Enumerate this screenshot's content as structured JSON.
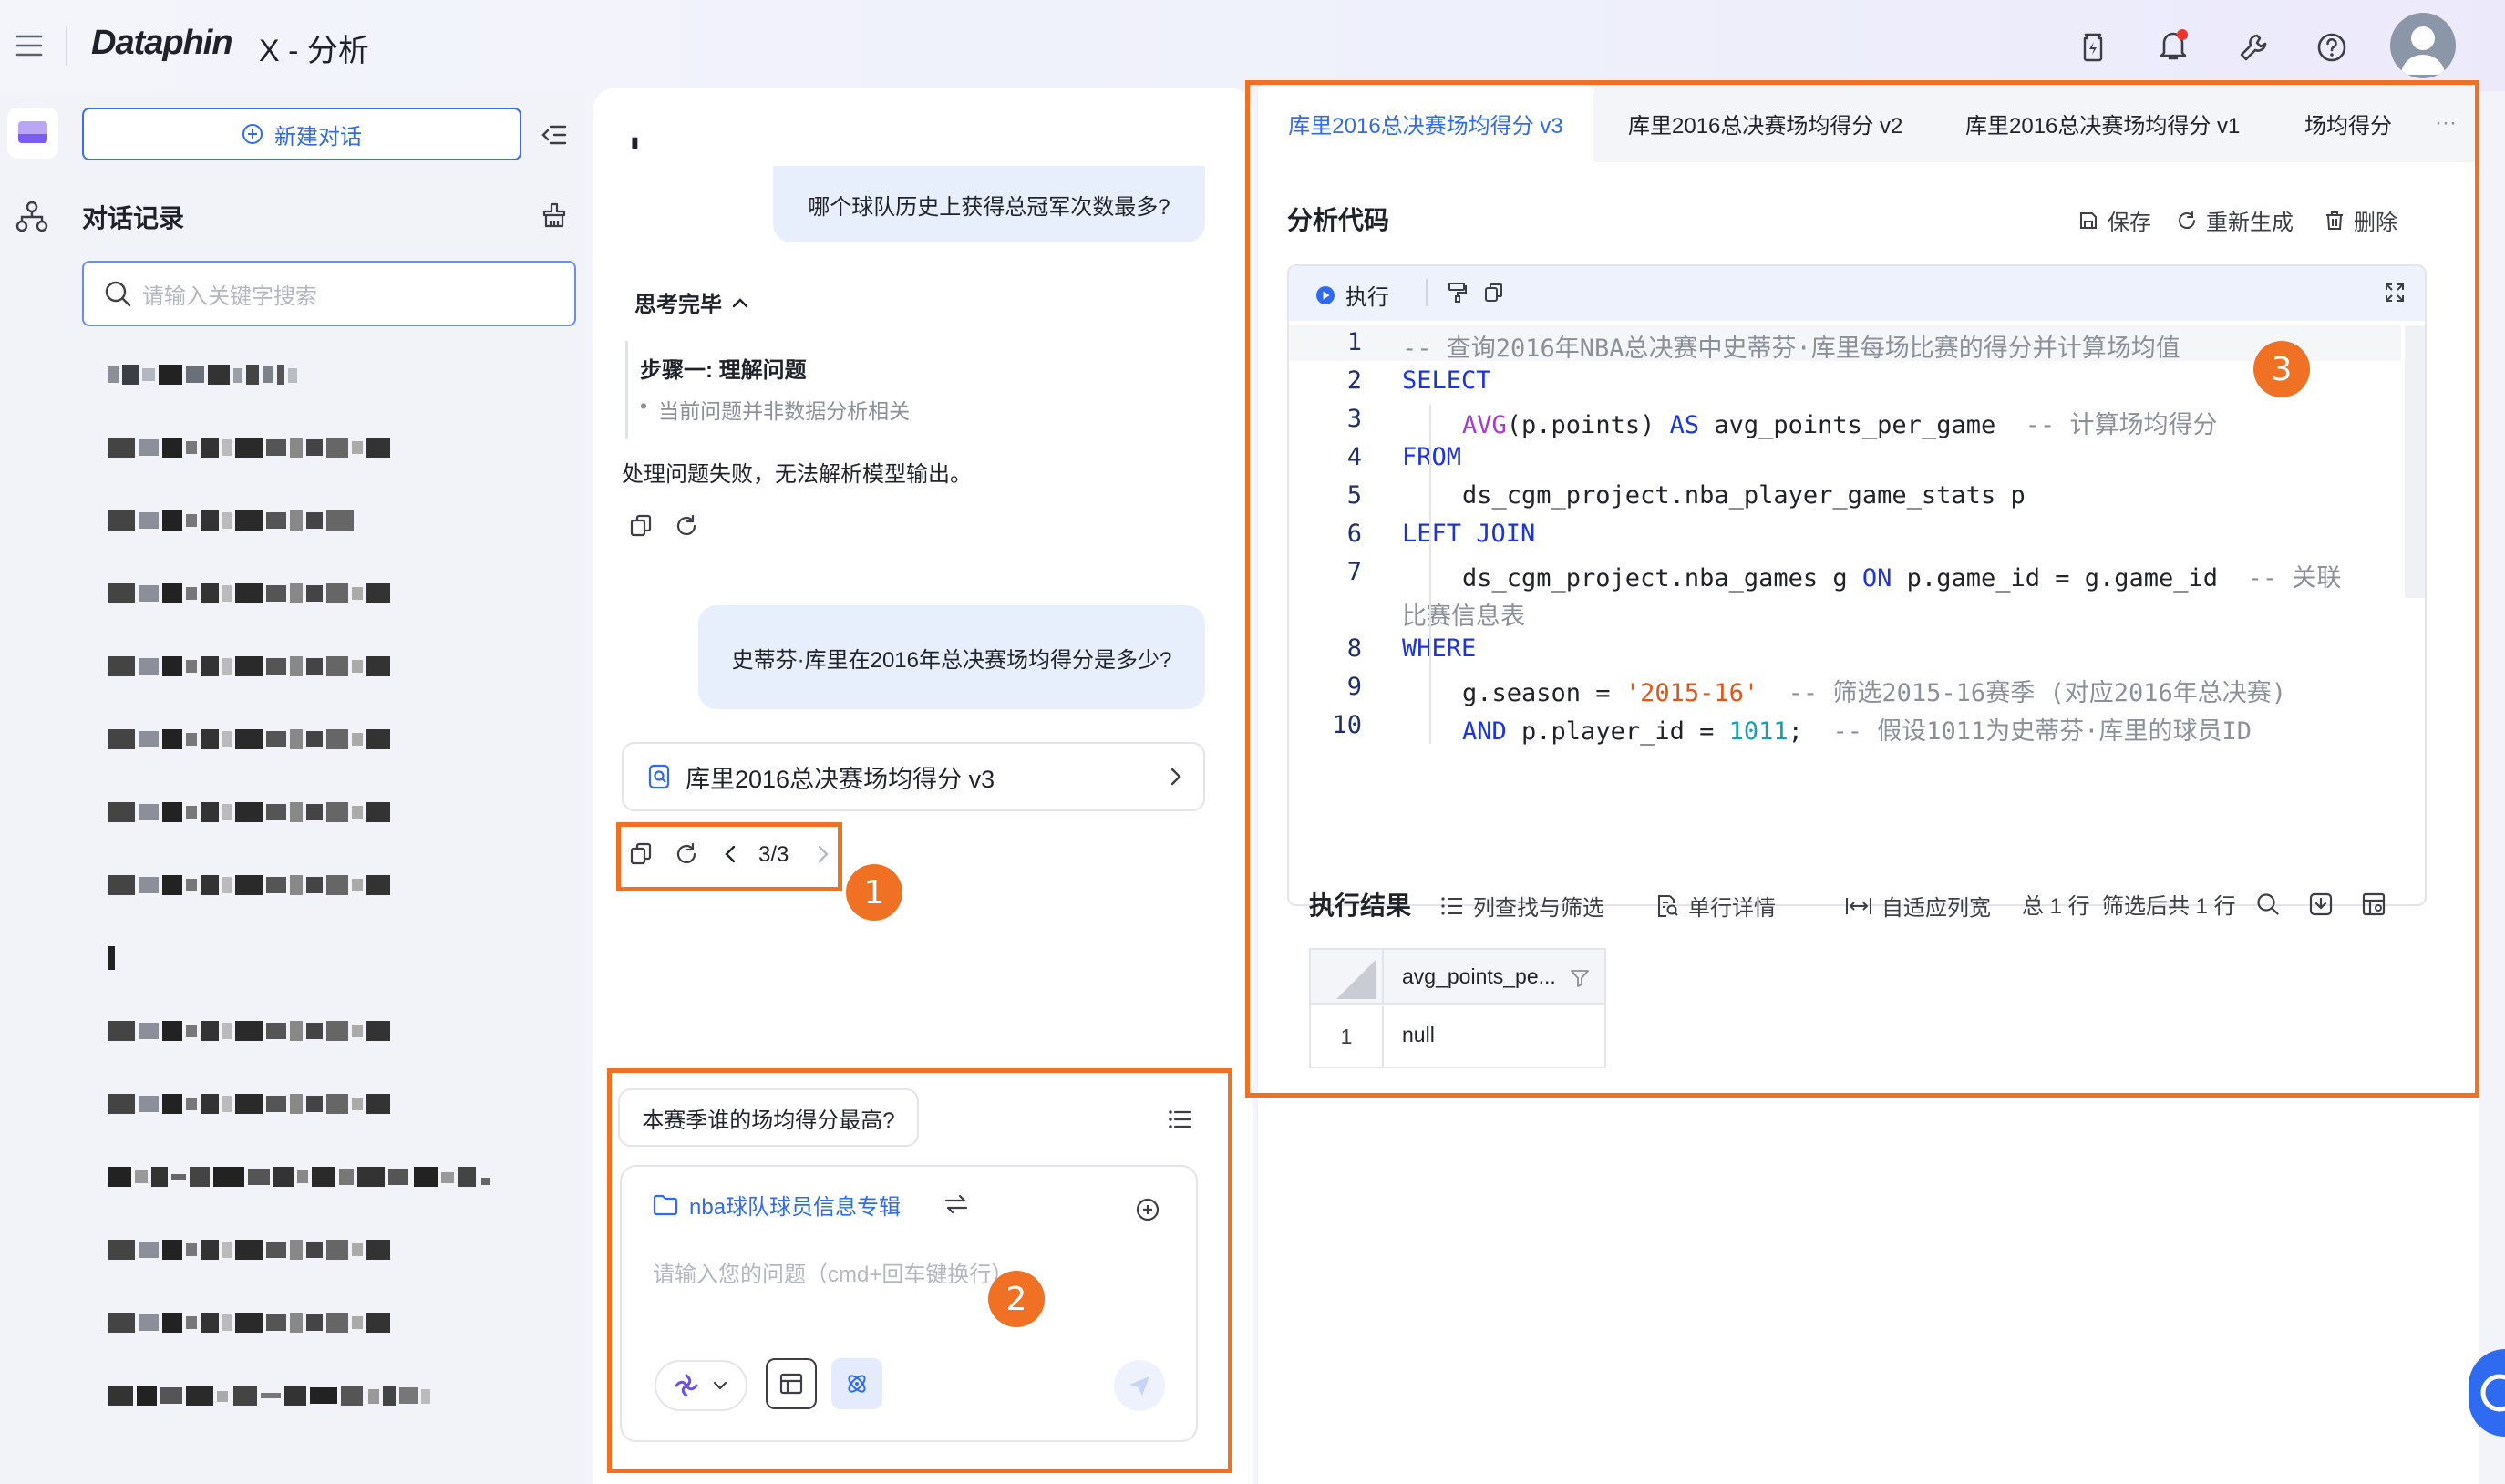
{
  "app": {
    "logo": "Dataphin",
    "title": "X - 分析"
  },
  "colors": {
    "accent": "#2f6bf1",
    "highlight": "#f07124",
    "bubble": "#e8effc"
  },
  "sidebar": {
    "new_chat": "新建对话",
    "history_title": "对话记录",
    "search_placeholder": "请输入关键字搜索"
  },
  "chat": {
    "cursor_mark": "▮",
    "q1": "哪个球队历史上获得总冠军次数最多?",
    "thinking_label": "思考完毕",
    "step_title": "步骤一: 理解问题",
    "step_detail": "当前问题并非数据分析相关",
    "error_text": "处理问题失败，无法解析模型输出。",
    "q2": "史蒂芬·库里在2016年总决赛场均得分是多少?",
    "result_card": "库里2016总决赛场均得分 v3",
    "pager": "3/3",
    "suggestion": "本赛季谁的场均得分最高?",
    "dataset": "nba球队球员信息专辑",
    "input_placeholder": "请输入您的问题（cmd+回车键换行）"
  },
  "badges": {
    "b1": "1",
    "b2": "2",
    "b3": "3"
  },
  "right": {
    "tabs": [
      "库里2016总决赛场均得分 v3",
      "库里2016总决赛场均得分 v2",
      "库里2016总决赛场均得分 v1",
      "场均得分"
    ],
    "more": "···",
    "section_title": "分析代码",
    "save": "保存",
    "regenerate": "重新生成",
    "delete": "删除",
    "run": "执行",
    "code_lines": {
      "l1": "-- 查询2016年NBA总决赛中史蒂芬·库里每场比赛的得分并计算场均值",
      "l2": "SELECT",
      "l3_fn": "AVG",
      "l3_a": "(p.points) ",
      "l3_as": "AS",
      "l3_b": " avg_points_per_game  ",
      "l3_c": "-- 计算场均得分",
      "l4": "FROM",
      "l5": "ds_cgm_project.nba_player_game_stats p",
      "l6": "LEFT JOIN",
      "l7_a": "ds_cgm_project.nba_games g ",
      "l7_on": "ON",
      "l7_b": " p.game_id = g.game_id  ",
      "l7_c": "-- 关联",
      "l7_wrap": "比赛信息表",
      "l8": "WHERE",
      "l9_a": "g.season = ",
      "l9_s": "'2015-16'",
      "l9_c": "  -- 筛选2015-16赛季 (对应2016年总决赛)",
      "l10_and": "AND",
      "l10_a": " p.player_id = ",
      "l10_n": "1011",
      "l10_b": ";  ",
      "l10_c": "-- 假设1011为史蒂芬·库里的球员ID"
    },
    "results_title": "执行结果",
    "col_filter": "列查找与筛选",
    "row_detail": "单行详情",
    "autofit": "自适应列宽",
    "total": "总 1 行",
    "filtered": "筛选后共 1 行",
    "table": {
      "header": "avg_points_pe...",
      "row_no": "1",
      "cell": "null"
    }
  }
}
